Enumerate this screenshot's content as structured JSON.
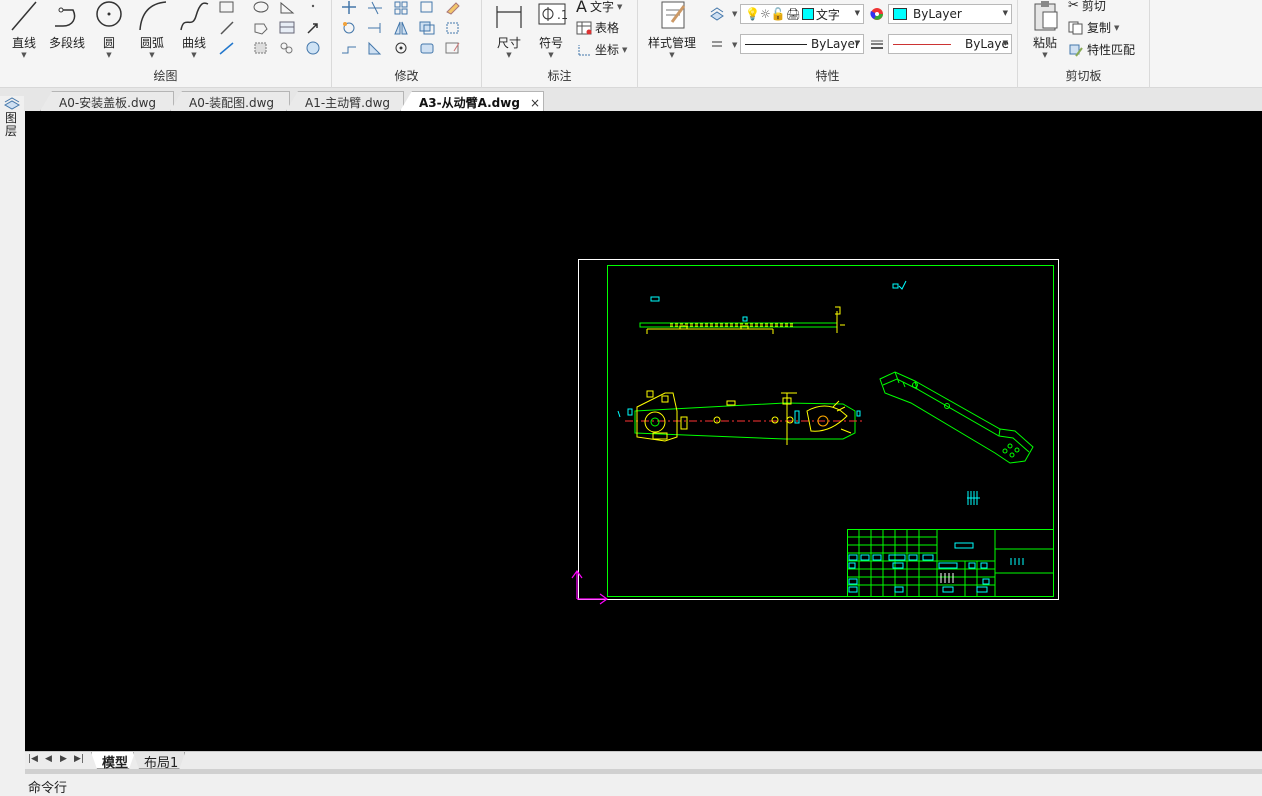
{
  "ribbon": {
    "draw": {
      "label": "绘图",
      "line": "直线",
      "polyline": "多段线",
      "circle": "圆",
      "arc": "圆弧",
      "curve": "曲线"
    },
    "modify": {
      "label": "修改"
    },
    "annotate": {
      "label": "标注",
      "dimension": "尺寸",
      "symbol": "符号",
      "text": "文字",
      "table": "表格",
      "coordinate": "坐标"
    },
    "properties": {
      "label": "特性",
      "style_manager": "样式管理",
      "text_style": "文字",
      "color": "ByLayer",
      "linetype": "ByLayer",
      "lineweight": "ByLaye"
    },
    "clipboard": {
      "label": "剪切板",
      "paste": "粘贴",
      "cut": "剪切",
      "copy": "复制",
      "match_props": "特性匹配"
    }
  },
  "left_strip": {
    "label": "图层"
  },
  "doc_tabs": [
    {
      "label": "A0-安装盖板.dwg",
      "active": false
    },
    {
      "label": "A0-装配图.dwg",
      "active": false
    },
    {
      "label": "A1-主动臂.dwg",
      "active": false
    },
    {
      "label": "A3-从动臂A.dwg",
      "active": true
    }
  ],
  "close_glyph": "×",
  "layout_tabs": [
    {
      "label": "模型",
      "active": true
    },
    {
      "label": "布局1",
      "active": false
    }
  ],
  "command_line": {
    "label": "命令行"
  },
  "colors": {
    "canvas": "#000000",
    "drawing_green": "#00ff00",
    "drawing_yellow": "#ffff00",
    "drawing_cyan": "#00ffff",
    "ucs_magenta": "#ff00ff",
    "accent_swatch": "#00ffff"
  }
}
